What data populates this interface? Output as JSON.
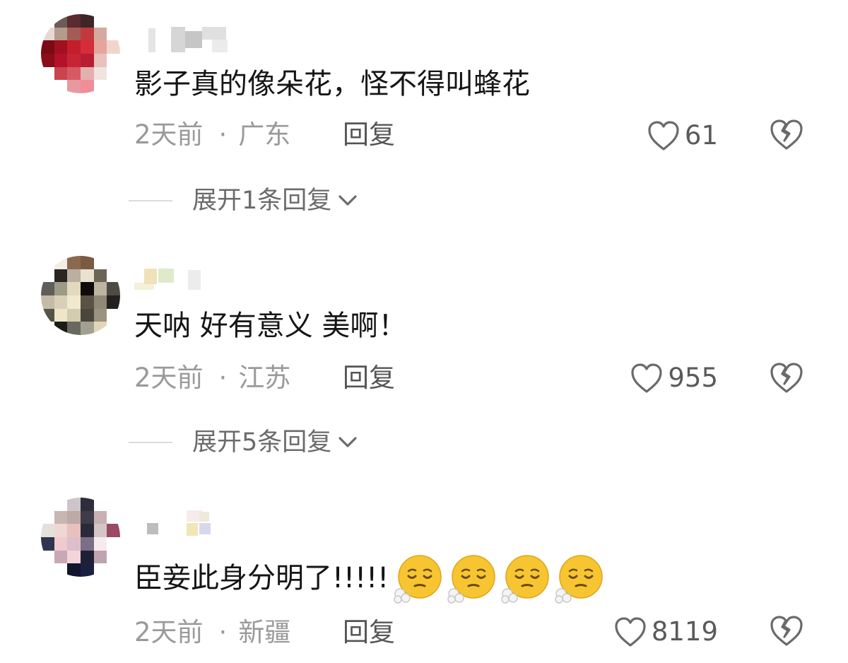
{
  "comments": [
    {
      "text": "影子真的像朵花，怪不得叫蜂花",
      "time": "2天前",
      "location": "广东",
      "dot": "·",
      "reply_label": "回复",
      "likes": "61",
      "expand_label": "展开1条回复"
    },
    {
      "text": "天呐 好有意义 美啊！",
      "time": "2天前",
      "location": "江苏",
      "dot": "·",
      "reply_label": "回复",
      "likes": "955",
      "expand_label": "展开5条回复"
    },
    {
      "text": "臣妾此身分明了!!!!!",
      "time": "2天前",
      "location": "新疆",
      "dot": "·",
      "reply_label": "回复",
      "likes": "8119",
      "emoji": "face-exhaling-emoji",
      "emoji_count": 4
    }
  ],
  "icons": {
    "like": "heart-outline-icon",
    "dislike": "broken-heart-icon",
    "expand": "chevron-down-icon"
  },
  "colors": {
    "text": "#151515",
    "meta": "#9a9a9a",
    "emoji": "#f7c531"
  }
}
